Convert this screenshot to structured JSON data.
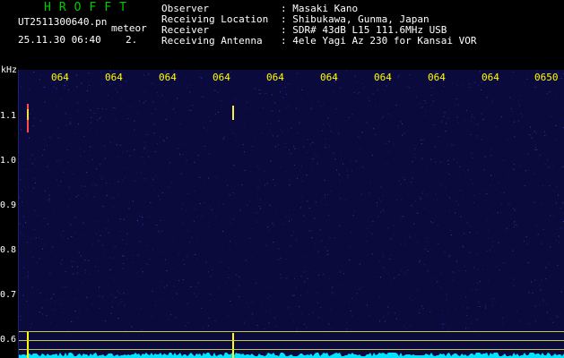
{
  "header": {
    "brand": "HROFFT",
    "filename": "UT2511300640.pn",
    "meteor_label": "meteor",
    "timestamp": "25.11.30 06:40",
    "count": "2."
  },
  "info": [
    {
      "key": "Observer",
      "value": ": Masaki Kano"
    },
    {
      "key": "Receiving Location",
      "value": ": Shibukawa, Gunma, Japan"
    },
    {
      "key": "Receiver",
      "value": ": SDR# 43dB L15 111.6MHz USB"
    },
    {
      "key": "Receiving Antenna",
      "value": ": 4ele Yagi Az 230 for Kansai VOR"
    }
  ],
  "axis": {
    "unit": "kHz",
    "x_ticks": [
      "064",
      "064",
      "064",
      "064",
      "064",
      "064",
      "064",
      "064",
      "064",
      "0650"
    ],
    "y_ticks": [
      "1.1",
      "1.0",
      "0.9",
      "0.8",
      "0.7",
      "0.6"
    ]
  },
  "colors": {
    "background": "#0b0a3d",
    "tick_time": "#ffff00",
    "brand": "#00cc00",
    "trace": "#00e5ff"
  }
}
